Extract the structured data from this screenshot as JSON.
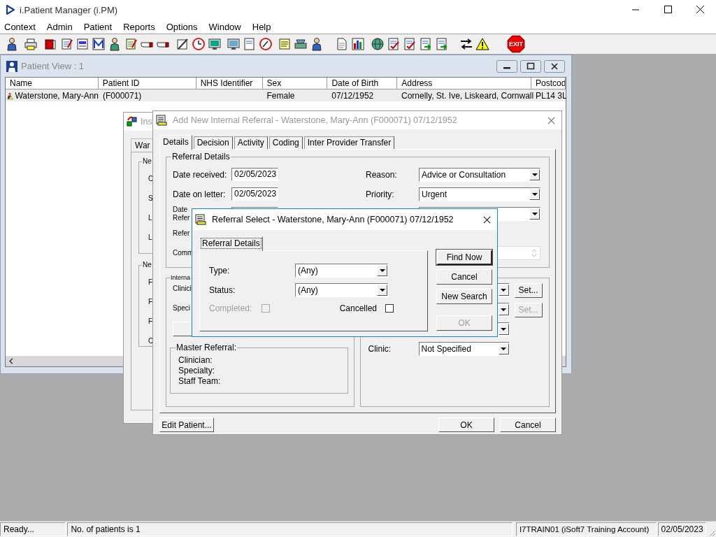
{
  "app": {
    "title": "i.Patient Manager (i.PM)"
  },
  "menu": [
    {
      "label": "Context"
    },
    {
      "label": "Admin"
    },
    {
      "label": "Patient"
    },
    {
      "label": "Reports"
    },
    {
      "label": "Options"
    },
    {
      "label": "Window"
    },
    {
      "label": "Help"
    }
  ],
  "toolbar": {
    "exit_label": "EXIT"
  },
  "patient_view": {
    "title": "Patient View : 1",
    "columns": {
      "name": "Name",
      "patient_id": "Patient ID",
      "nhs_identifier": "NHS Identifier",
      "sex": "Sex",
      "date_of_birth": "Date of Birth",
      "address": "Address",
      "postcode": "Postcod"
    },
    "rows": [
      {
        "name": "Waterstone, Mary-Ann",
        "patient_id": "(F000071)",
        "sex": "Female",
        "date_of_birth": "07/12/1952",
        "address": "Cornelly, St. Ive, Liskeard, Cornwall",
        "postcode": "PL14 3L",
        "selected": true
      }
    ]
  },
  "insert_window": {
    "title": "Ins",
    "tab": "War",
    "groups": [
      {
        "legend": "Ne",
        "labels": [
          "C",
          "S",
          "L",
          "L"
        ]
      },
      {
        "legend": "Ne",
        "labels": [
          "F",
          "F",
          "F",
          "C"
        ]
      }
    ]
  },
  "referral_window": {
    "title": "Add New Internal Referral - Waterstone, Mary-Ann (F000071) 07/12/1952",
    "tabs": [
      {
        "label": "Details",
        "selected": true
      },
      {
        "label": "Decision",
        "selected": false
      },
      {
        "label": "Activity",
        "selected": false
      },
      {
        "label": "Coding",
        "selected": false
      },
      {
        "label": "Inter Provider Transfer",
        "selected": false
      }
    ],
    "referral_details": {
      "legend": "Referral Details",
      "dates": [
        {
          "label": "Date received:",
          "value": "02/05/2023"
        },
        {
          "label": "Date on letter:",
          "value": "02/05/2023"
        }
      ],
      "partial_labels": [
        "Date",
        "Refer",
        "Refer",
        "Comm"
      ],
      "reason": {
        "label": "Reason:",
        "value": "Advice or Consultation"
      },
      "priority": {
        "label": "Priority:",
        "value": "Urgent"
      }
    },
    "internal": {
      "legend": "Interna",
      "labels": [
        "Clinici",
        "Speci"
      ],
      "set_buttons": [
        {
          "label": "Set...",
          "disabled": false
        },
        {
          "label": "Set...",
          "disabled": true
        }
      ],
      "clinic": {
        "label": "Clinic:",
        "value": "Not Specified"
      }
    },
    "master_referral": {
      "legend": "Master Referral:",
      "labels": [
        "Clinician:",
        "Specialty:",
        "Staff Team:"
      ]
    },
    "edit_button": "Edit Patient...",
    "buttons": [
      "OK",
      "Cancel"
    ]
  },
  "referral_select": {
    "title": "Referral Select - Waterstone, Mary-Ann (F000071) 07/12/1952",
    "tab": {
      "label": "Referral Details",
      "selected": true
    },
    "type": {
      "label": "Type:",
      "value": "(Any)"
    },
    "status": {
      "label": "Status:",
      "value": "(Any)"
    },
    "checkboxes": [
      {
        "label": "Completed:",
        "checked": false,
        "disabled": true
      },
      {
        "label": "Cancelled",
        "checked": false,
        "disabled": false
      }
    ],
    "buttons": [
      {
        "label": "Find Now",
        "default": true,
        "disabled": false
      },
      {
        "label": "Cancel",
        "default": false,
        "disabled": false
      },
      {
        "label": "New Search",
        "default": false,
        "disabled": false
      },
      {
        "label": "OK",
        "default": false,
        "disabled": true
      }
    ]
  },
  "status_bar": [
    "Ready...",
    "No. of patients is 1",
    "I7TRAIN01 (iSoft7 Training Account)",
    "02/05/2023"
  ]
}
